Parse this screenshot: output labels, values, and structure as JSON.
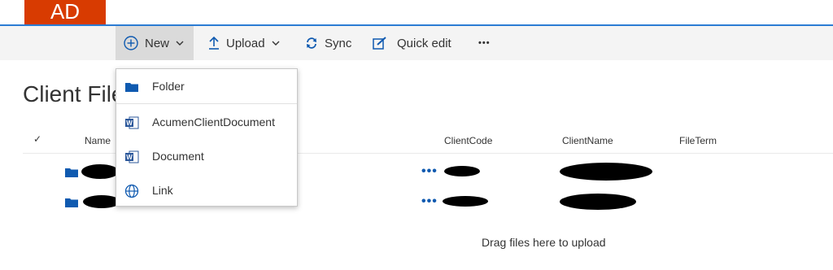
{
  "site": {
    "logo_text": "AD"
  },
  "commands": {
    "new_label": "New",
    "upload_label": "Upload",
    "sync_label": "Sync",
    "quick_edit_label": "Quick edit",
    "more_label": "•••"
  },
  "page": {
    "title": "Client Files"
  },
  "columns": {
    "check": "✓",
    "name": "Name",
    "client_code": "ClientCode",
    "client_name": "ClientName",
    "file_term": "FileTerm"
  },
  "rows": [
    {
      "menu": "•••"
    },
    {
      "menu": "•••"
    }
  ],
  "new_menu": {
    "items": [
      {
        "label": "Folder",
        "icon": "folder-icon"
      },
      {
        "label": "AcumenClientDocument",
        "icon": "word-icon"
      },
      {
        "label": "Document",
        "icon": "word-icon"
      },
      {
        "label": "Link",
        "icon": "globe-icon"
      }
    ]
  },
  "drop_message": "Drag files here to upload",
  "colors": {
    "accent": "#2b7cd3",
    "logo_bg": "#d83b01",
    "folder": "#0f5ab0",
    "word": "#2b579a"
  }
}
